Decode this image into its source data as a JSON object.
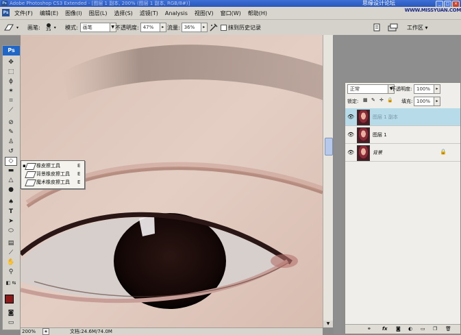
{
  "window": {
    "title": "Adobe Photoshop CS3 Extended - [图层 1 副本, 200% (图层 1 副本, RGB/8#)]",
    "watermark": "思缘设计论坛",
    "controls": [
      "_",
      "□",
      "×"
    ]
  },
  "menubar": {
    "app_badge": "Ps",
    "items": [
      "文件(F)",
      "编辑(E)",
      "图像(I)",
      "图层(L)",
      "选择(S)",
      "滤镜(T)",
      "Analysis",
      "视图(V)",
      "窗口(W)",
      "帮助(H)"
    ],
    "site_watermark": "WWW.MISSYUAN.COM"
  },
  "options": {
    "brush_label": "画笔:",
    "brush_size": "35",
    "mode_label": "模式:",
    "mode_value": "画笔",
    "opacity_label": "不透明度:",
    "opacity_value": "47%",
    "flow_label": "流量:",
    "flow_value": "36%",
    "erase_history_label": "抹到历史记录",
    "workspace_label": "工作区 ▾"
  },
  "toolbox": {
    "logo": "Ps"
  },
  "flyout": {
    "items": [
      {
        "label": "橡皮擦工具",
        "key": "E",
        "active": true
      },
      {
        "label": "背景橡皮擦工具",
        "key": "E",
        "active": false
      },
      {
        "label": "魔术橡皮擦工具",
        "key": "E",
        "active": false
      }
    ]
  },
  "status": {
    "zoom": "200%",
    "doc_size": "文档:24.6M/74.0M"
  },
  "layers_panel": {
    "blend_mode": "正常",
    "opacity_label": "不透明度:",
    "opacity_value": "100%",
    "lock_label": "锁定:",
    "fill_label": "填充:",
    "fill_value": "100%",
    "layers": [
      {
        "name": "图层 1 副本",
        "selected": true,
        "locked": false
      },
      {
        "name": "图层 1",
        "selected": false,
        "locked": false
      },
      {
        "name": "背景",
        "selected": false,
        "locked": true
      }
    ],
    "bottom_icons": [
      "link-icon",
      "fx",
      "mask-icon",
      "adjustment-icon",
      "folder-icon",
      "new-layer-icon",
      "trash-icon"
    ]
  },
  "colors": {
    "foreground": "#8b1a1a",
    "background": "#ffffff",
    "selection": "#b7dbe9"
  }
}
